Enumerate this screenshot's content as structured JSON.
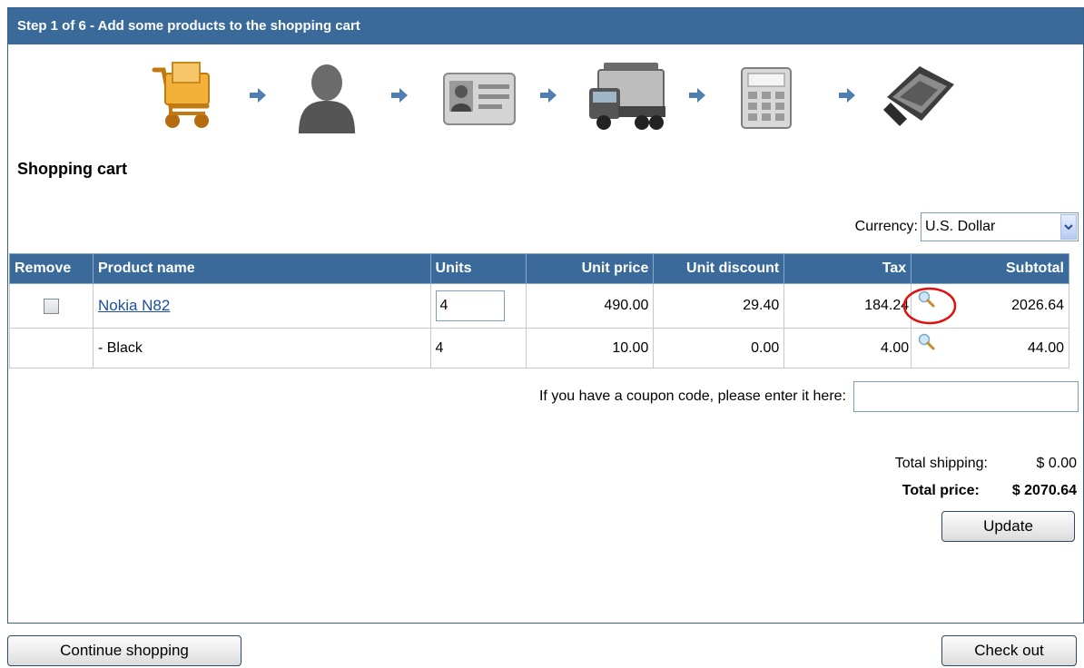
{
  "header": {
    "title": "Step 1 of 6 - Add some products to the shopping cart"
  },
  "steps": [
    {
      "icon": "shopping-cart-icon"
    },
    {
      "icon": "person-icon"
    },
    {
      "icon": "id-card-icon"
    },
    {
      "icon": "delivery-truck-icon"
    },
    {
      "icon": "calculator-icon"
    },
    {
      "icon": "wallet-icon"
    }
  ],
  "cart": {
    "title": "Shopping cart",
    "currency_label": "Currency:",
    "currency_value": "U.S. Dollar",
    "columns": [
      "Remove",
      "Product name",
      "Units",
      "Unit price",
      "Unit discount",
      "Tax",
      "Subtotal"
    ],
    "rows": [
      {
        "product": "Nokia N82",
        "units": "4",
        "unit_price": "490.00",
        "unit_discount": "29.40",
        "tax": "184.24",
        "subtotal": "2026.64"
      },
      {
        "product": "- Black",
        "units": "4",
        "unit_price": "10.00",
        "unit_discount": "0.00",
        "tax": "4.00",
        "subtotal": "44.00"
      }
    ]
  },
  "coupon": {
    "label": "If you have a coupon code, please enter it here:",
    "value": ""
  },
  "totals": {
    "shipping_label": "Total shipping:",
    "shipping_value": "$ 0.00",
    "price_label": "Total price:",
    "price_value": "$ 2070.64"
  },
  "buttons": {
    "update": "Update",
    "continue": "Continue shopping",
    "checkout": "Check out"
  }
}
